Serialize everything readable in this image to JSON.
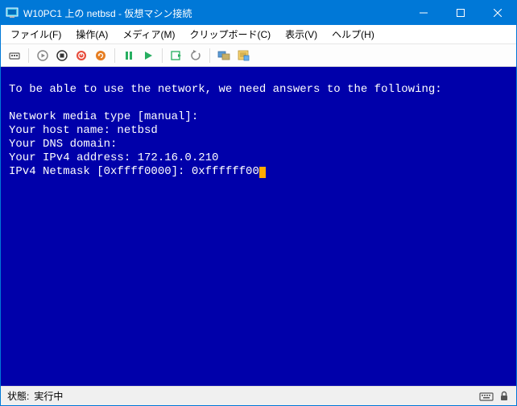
{
  "titlebar": {
    "title": "W10PC1 上の netbsd - 仮想マシン接続"
  },
  "menu": {
    "file": "ファイル(F)",
    "action": "操作(A)",
    "media": "メディア(M)",
    "clipboard": "クリップボード(C)",
    "view": "表示(V)",
    "help": "ヘルプ(H)"
  },
  "terminal": {
    "line1": "To be able to use the network, we need answers to the following:",
    "line2": "",
    "line3": "Network media type [manual]:",
    "line4": "Your host name: netbsd",
    "line5": "Your DNS domain:",
    "line6": "Your IPv4 address: 172.16.0.210",
    "line7": "IPv4 Netmask [0xffff0000]: 0xffffff00"
  },
  "status": {
    "label": "状態:",
    "value": "実行中"
  }
}
